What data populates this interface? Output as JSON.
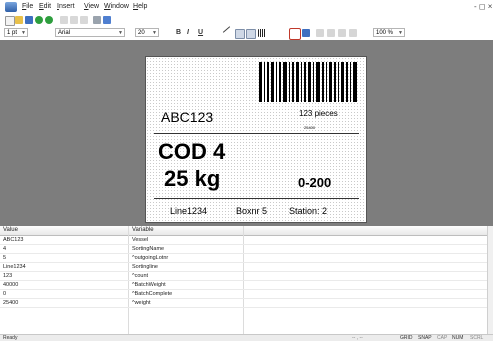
{
  "menubar": {
    "items": [
      "File",
      "Edit",
      "Insert",
      "View",
      "Window",
      "Help"
    ],
    "window_controls": "- ◻ ×"
  },
  "toolbar": {
    "font_size_left": "1 pt",
    "font_name": "Arial",
    "font_size": "20",
    "bold": "B",
    "italic": "I",
    "underline": "U",
    "zoom": "100 %"
  },
  "label": {
    "code": "ABC123",
    "pieces": "123 pieces",
    "barcode_text": "25400",
    "cod": "COD 4",
    "weight": "25 kg",
    "range": "0-200",
    "line": "Line1234",
    "boxnr": "Boxnr 5",
    "station": "Station: 2"
  },
  "grid": {
    "headers": [
      "Value",
      "Variable"
    ],
    "rows": [
      {
        "value": "ABC123",
        "variable": "Vessel"
      },
      {
        "value": "4",
        "variable": "SortingName"
      },
      {
        "value": "5",
        "variable": "^outgoingLotnr"
      },
      {
        "value": "Line1234",
        "variable": "Sortingline"
      },
      {
        "value": "123",
        "variable": "^count"
      },
      {
        "value": "40000",
        "variable": "^BatchWeight"
      },
      {
        "value": "0",
        "variable": "^BatchComplete"
      },
      {
        "value": "25400",
        "variable": "^weight"
      }
    ]
  },
  "status": {
    "left": "Ready",
    "coords": "-- , --",
    "indicators": [
      "GRID",
      "SNAP",
      "CAP",
      "NUM",
      "SCRL"
    ]
  },
  "colors": {
    "workspace": "#7d7d7d",
    "toolbar_blue": "#3d6fc0",
    "toolbar_red": "#c0392b",
    "toolbar_green": "#2e9e3e"
  }
}
